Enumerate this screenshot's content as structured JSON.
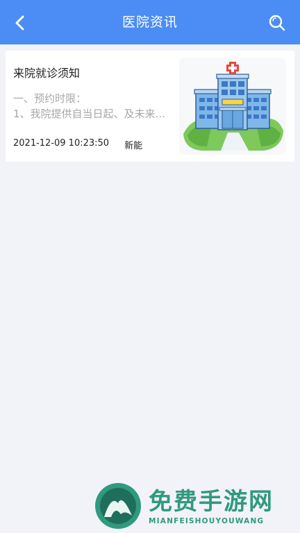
{
  "header": {
    "title": "医院资讯",
    "back_icon": "chevron-left-icon",
    "search_icon": "search-icon",
    "bar_color": "#4b8cf5"
  },
  "news": [
    {
      "title": "来院就诊须知",
      "summary_line1": "一、预约时限：",
      "summary_line2": "1、我院提供自当日起、及未来...",
      "datetime": "2021-12-09 10:23:50",
      "author": "新能",
      "thumbnail_icon": "hospital-illustration"
    }
  ],
  "watermark": {
    "title": "免费手游网",
    "subtitle": "MIANFEISHOUYOUWANG"
  }
}
